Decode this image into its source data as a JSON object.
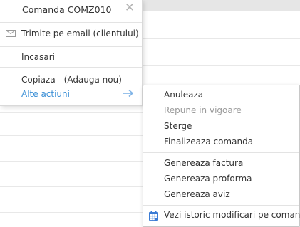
{
  "menu": {
    "title": "Comanda COMZ010",
    "close_glyph": "✕",
    "items": [
      {
        "label": "Trimite pe email (clientului)",
        "icon": "mail-icon"
      },
      {
        "label": "Incasari"
      },
      {
        "label": "Copiaza - (Adauga nou)"
      },
      {
        "label": "Alte actiuni",
        "icon": "arrow-right-icon"
      }
    ]
  },
  "submenu": {
    "items": [
      {
        "label": "Anuleaza",
        "enabled": true
      },
      {
        "label": "Repune in vigoare",
        "enabled": false
      },
      {
        "label": "Sterge",
        "enabled": true
      },
      {
        "label": "Finalizeaza comanda",
        "enabled": true
      },
      {
        "label": "Genereaza factura",
        "enabled": true
      },
      {
        "label": "Genereaza proforma",
        "enabled": true
      },
      {
        "label": "Genereaza aviz",
        "enabled": true
      },
      {
        "label": "Vezi istoric modificari pe comanda",
        "icon": "calendar-icon",
        "enabled": true
      }
    ]
  },
  "colors": {
    "link": "#3a8fd6",
    "disabled": "#999999",
    "icon_blue": "#3a7bd5"
  }
}
